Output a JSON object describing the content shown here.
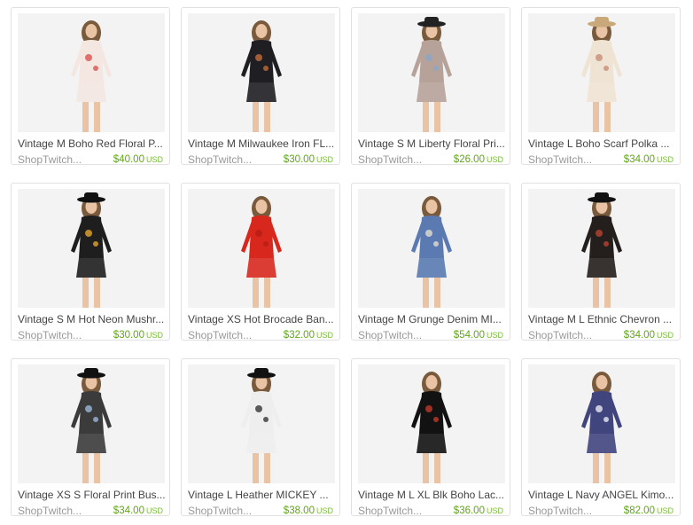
{
  "listings": [
    {
      "title": "Vintage M Boho Red Floral P...",
      "shop": "ShopTwitch...",
      "price": "$40.00",
      "currency": "USD",
      "garment": "#f4e7e2",
      "accent": "#d9534f",
      "hat": false
    },
    {
      "title": "Vintage M Milwaukee Iron FL...",
      "shop": "ShopTwitch...",
      "price": "$30.00",
      "currency": "USD",
      "garment": "#1f1f23",
      "accent": "#c36b3a",
      "hat": false
    },
    {
      "title": "Vintage S M Liberty Floral Pri...",
      "shop": "ShopTwitch...",
      "price": "$26.00",
      "currency": "USD",
      "garment": "#b7a29a",
      "accent": "#8aa6c8",
      "hat": true,
      "hatColor": "#222"
    },
    {
      "title": "Vintage L Boho Scarf Polka ...",
      "shop": "ShopTwitch...",
      "price": "$34.00",
      "currency": "USD",
      "garment": "#efe3d4",
      "accent": "#c88d77",
      "hat": true,
      "hatColor": "#c9a97a"
    },
    {
      "title": "Vintage S M Hot Neon Mushr...",
      "shop": "ShopTwitch...",
      "price": "$30.00",
      "currency": "USD",
      "garment": "#1e1e1e",
      "accent": "#e3a52b",
      "hat": true,
      "hatColor": "#111"
    },
    {
      "title": "Vintage XS Hot Brocade Ban...",
      "shop": "ShopTwitch...",
      "price": "$32.00",
      "currency": "USD",
      "garment": "#d8281e",
      "accent": "#b61d15",
      "hat": false
    },
    {
      "title": "Vintage M Grunge Denim MI...",
      "shop": "ShopTwitch...",
      "price": "$54.00",
      "currency": "USD",
      "garment": "#5a7ab1",
      "accent": "#e2ddd2",
      "hat": false
    },
    {
      "title": "Vintage M L Ethnic Chevron ...",
      "shop": "ShopTwitch...",
      "price": "$34.00",
      "currency": "USD",
      "garment": "#241e1c",
      "accent": "#b8432f",
      "hat": true,
      "hatColor": "#111"
    },
    {
      "title": "Vintage XS S Floral Print Bus...",
      "shop": "ShopTwitch...",
      "price": "$34.00",
      "currency": "USD",
      "garment": "#3b3b3b",
      "accent": "#9bb6d9",
      "hat": true,
      "hatColor": "#111"
    },
    {
      "title": "Vintage L Heather MICKEY ...",
      "shop": "ShopTwitch...",
      "price": "$38.00",
      "currency": "USD",
      "garment": "#eeeeee",
      "accent": "#333333",
      "hat": true,
      "hatColor": "#111"
    },
    {
      "title": "Vintage M L XL Blk Boho Lac...",
      "shop": "ShopTwitch...",
      "price": "$36.00",
      "currency": "USD",
      "garment": "#121212",
      "accent": "#c0392b",
      "hat": false
    },
    {
      "title": "Vintage L Navy ANGEL Kimo...",
      "shop": "ShopTwitch...",
      "price": "$82.00",
      "currency": "USD",
      "garment": "#40457e",
      "accent": "#e8e8f2",
      "hat": false
    }
  ]
}
